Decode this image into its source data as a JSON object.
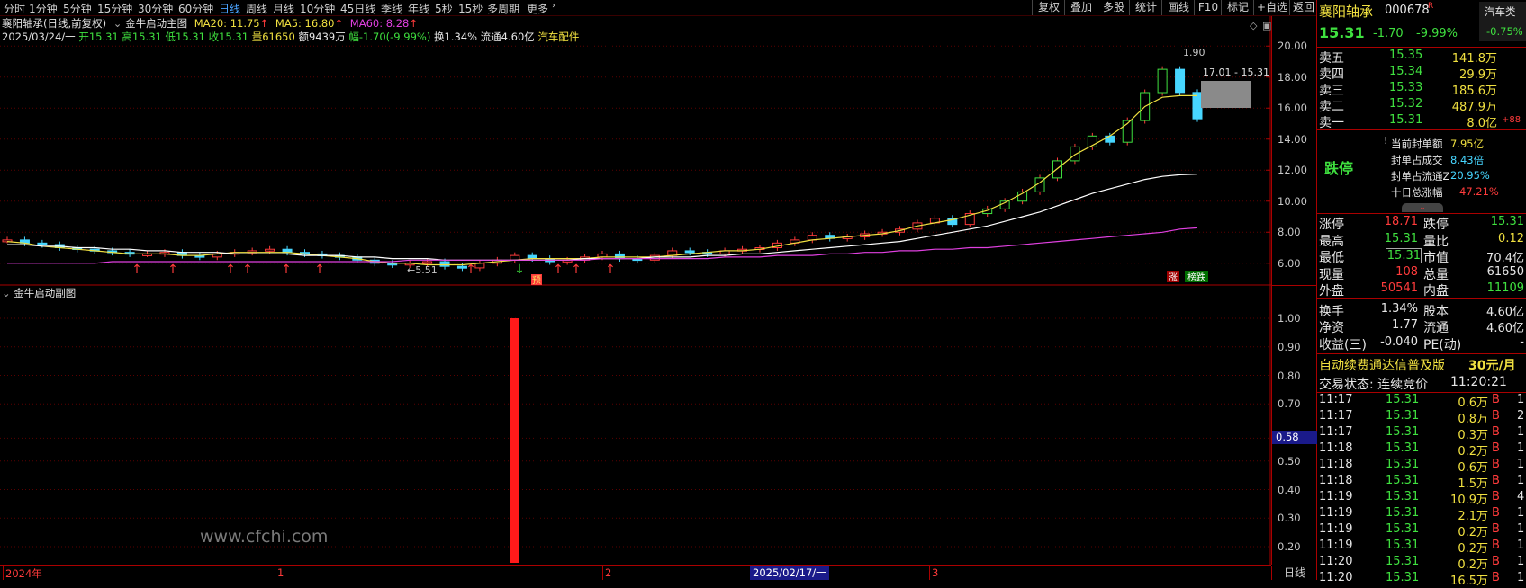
{
  "toolbar": {
    "periods": [
      "分时",
      "1分钟",
      "5分钟",
      "15分钟",
      "30分钟",
      "60分钟",
      "日线",
      "周线",
      "月线",
      "10分钟",
      "45日线",
      "季线",
      "年线",
      "5秒",
      "15秒",
      "多周期",
      "更多"
    ],
    "active": "日线",
    "right_buttons": [
      "复权",
      "叠加",
      "多股",
      "统计",
      "画线",
      "F10",
      "标记",
      "+自选",
      "返回"
    ]
  },
  "chart_header": {
    "title": "襄阳轴承(日线,前复权)",
    "indicator": "金牛启动主图",
    "ma20": "MA20: 11.75",
    "ma5": "MA5: 16.80",
    "ma60": "MA60: 8.28",
    "ohlc_line": {
      "date": "2025/03/24/一",
      "open": "开15.31",
      "high": "高15.31",
      "low": "低15.31",
      "close": "收15.31",
      "volume": "量61650",
      "amount": "额9439万",
      "change": "幅-1.70(-9.99%)",
      "turnover": "换1.34%",
      "float": "流通4.60亿",
      "sector": "汽车配件"
    },
    "colors": {
      "ma20": "#f0e040",
      "ma5": "#ffffff",
      "ma60": "#e040e0",
      "up": "#ff3b3b",
      "down": "#47d6ff"
    }
  },
  "sub_header": {
    "title": "金牛启动副图"
  },
  "annotations": {
    "low_label": "5.51",
    "high_label": "1.90",
    "range_label": "17.01 - 15.31",
    "yu_badge": "预",
    "zhang_badge": "涨",
    "bangdie_badge": "榜跌",
    "watermark": "www.cfchi.com",
    "cursor_value": "0.58"
  },
  "xaxis": {
    "labels": [
      "2024年",
      "1",
      "2",
      "3"
    ],
    "cursor_date": "2025/02/17/一",
    "period": "日线"
  },
  "main_axis_ticks": [
    "20.00",
    "18.00",
    "16.00",
    "14.00",
    "12.00",
    "10.00",
    "8.00",
    "6.00"
  ],
  "sub_axis_ticks": [
    "1.00",
    "0.90",
    "0.80",
    "0.70",
    "0.50",
    "0.40",
    "0.30",
    "0.20"
  ],
  "chart_data": {
    "type": "line",
    "title": "襄阳轴承(日线,前复权)",
    "ylim": [
      5.0,
      21.0
    ],
    "candles_close": [
      7.5,
      7.3,
      7.2,
      7.0,
      6.9,
      6.8,
      6.7,
      6.6,
      6.6,
      6.7,
      6.5,
      6.4,
      6.6,
      6.7,
      6.8,
      6.9,
      6.7,
      6.6,
      6.5,
      6.4,
      6.2,
      6.0,
      5.9,
      6.0,
      6.1,
      5.8,
      5.7,
      6.0,
      6.2,
      6.5,
      6.3,
      6.1,
      6.2,
      6.4,
      6.6,
      6.3,
      6.2,
      6.5,
      6.8,
      6.7,
      6.6,
      6.8,
      6.9,
      7.0,
      7.3,
      7.5,
      7.8,
      7.6,
      7.7,
      7.9,
      8.0,
      8.2,
      8.6,
      8.9,
      8.5,
      9.2,
      9.5,
      10.0,
      10.6,
      11.5,
      12.6,
      13.5,
      14.2,
      13.8,
      15.2,
      17.0,
      18.5,
      17.01,
      15.31
    ],
    "series": [
      {
        "name": "MA5",
        "values": [
          7.4,
          7.3,
          7.1,
          7.0,
          6.9,
          6.8,
          6.7,
          6.6,
          6.6,
          6.6,
          6.5,
          6.5,
          6.6,
          6.7,
          6.7,
          6.7,
          6.7,
          6.6,
          6.5,
          6.4,
          6.3,
          6.1,
          6.0,
          6.0,
          5.9,
          5.9,
          5.9,
          6.0,
          6.1,
          6.2,
          6.3,
          6.3,
          6.3,
          6.3,
          6.4,
          6.4,
          6.4,
          6.4,
          6.5,
          6.6,
          6.7,
          6.8,
          6.8,
          6.9,
          7.1,
          7.3,
          7.5,
          7.6,
          7.7,
          7.8,
          7.9,
          8.1,
          8.4,
          8.6,
          8.8,
          9.1,
          9.4,
          9.9,
          10.5,
          11.2,
          12.1,
          13.0,
          13.6,
          14.2,
          15.0,
          16.1,
          16.7,
          16.8,
          16.8
        ]
      },
      {
        "name": "MA20",
        "values": [
          7.2,
          7.2,
          7.1,
          7.1,
          7.0,
          7.0,
          6.9,
          6.9,
          6.8,
          6.8,
          6.7,
          6.7,
          6.7,
          6.6,
          6.6,
          6.6,
          6.6,
          6.5,
          6.5,
          6.5,
          6.4,
          6.4,
          6.3,
          6.3,
          6.3,
          6.2,
          6.2,
          6.2,
          6.2,
          6.2,
          6.2,
          6.2,
          6.2,
          6.3,
          6.3,
          6.3,
          6.3,
          6.4,
          6.4,
          6.4,
          6.5,
          6.5,
          6.6,
          6.6,
          6.7,
          6.8,
          6.9,
          7.0,
          7.1,
          7.2,
          7.3,
          7.4,
          7.6,
          7.8,
          8.0,
          8.2,
          8.4,
          8.7,
          9.0,
          9.3,
          9.7,
          10.1,
          10.5,
          10.8,
          11.1,
          11.4,
          11.6,
          11.7,
          11.75
        ]
      },
      {
        "name": "MA60",
        "values": [
          6.0,
          6.0,
          6.0,
          6.0,
          6.0,
          6.0,
          6.1,
          6.1,
          6.1,
          6.1,
          6.1,
          6.1,
          6.1,
          6.1,
          6.1,
          6.1,
          6.1,
          6.1,
          6.1,
          6.1,
          6.1,
          6.1,
          6.1,
          6.2,
          6.2,
          6.2,
          6.2,
          6.2,
          6.2,
          6.2,
          6.2,
          6.2,
          6.2,
          6.2,
          6.3,
          6.3,
          6.3,
          6.3,
          6.3,
          6.3,
          6.3,
          6.4,
          6.4,
          6.4,
          6.5,
          6.5,
          6.5,
          6.6,
          6.6,
          6.7,
          6.7,
          6.8,
          6.8,
          6.9,
          6.9,
          7.0,
          7.0,
          7.1,
          7.2,
          7.3,
          7.4,
          7.5,
          7.6,
          7.7,
          7.8,
          7.9,
          8.0,
          8.2,
          8.28
        ]
      }
    ]
  },
  "stock": {
    "name": "襄阳轴承",
    "code": "000678",
    "flag": "R",
    "price": "15.31",
    "change": "-1.70",
    "pct": "-9.99%",
    "sector_name": "汽车类",
    "sector_pct": "-0.75%"
  },
  "order_book": [
    {
      "label": "卖五",
      "price": "15.35",
      "vol": "141.8万",
      "extra": ""
    },
    {
      "label": "卖四",
      "price": "15.34",
      "vol": "29.9万",
      "extra": ""
    },
    {
      "label": "卖三",
      "price": "15.33",
      "vol": "185.6万",
      "extra": ""
    },
    {
      "label": "卖二",
      "price": "15.32",
      "vol": "487.9万",
      "extra": ""
    },
    {
      "label": "卖一",
      "price": "15.31",
      "vol": "8.0亿",
      "extra": "+88"
    }
  ],
  "limit_panel": {
    "status": "跌停",
    "lines": [
      {
        "label": "当前封单额",
        "value": "7.95亿"
      },
      {
        "label": "封单占成交",
        "value": "8.43倍"
      },
      {
        "label": "封单占流通Z",
        "value": "20.95%"
      },
      {
        "label": "十日总涨幅",
        "value": "47.21%"
      }
    ]
  },
  "stats": [
    {
      "l1": "涨停",
      "v1": "18.71",
      "l2": "跌停",
      "v2": "15.31"
    },
    {
      "l1": "最高",
      "v1": "15.31",
      "l2": "量比",
      "v2": "0.12"
    },
    {
      "l1": "最低",
      "v1": "15.31",
      "l2": "市值",
      "v2": "70.4亿"
    },
    {
      "l1": "现量",
      "v1": "108",
      "l2": "总量",
      "v2": "61650"
    },
    {
      "l1": "外盘",
      "v1": "50541",
      "l2": "内盘",
      "v2": "11109"
    },
    {
      "l1": "换手",
      "v1": "1.34%",
      "l2": "股本",
      "v2": "4.60亿"
    },
    {
      "l1": "净资",
      "v1": "1.77",
      "l2": "流通",
      "v2": "4.60亿"
    },
    {
      "l1": "收益(三)",
      "v1": "-0.040",
      "l2": "PE(动)",
      "v2": "-"
    }
  ],
  "promo": {
    "text": "自动续费通达信普及版",
    "price": "30元/月"
  },
  "trade_status": {
    "label": "交易状态: 连续竞价",
    "time": "11:20:21"
  },
  "ticks": [
    {
      "t": "11:17",
      "p": "15.31",
      "v": "0.6万",
      "bs": "B",
      "n": "1"
    },
    {
      "t": "11:17",
      "p": "15.31",
      "v": "0.8万",
      "bs": "B",
      "n": "2"
    },
    {
      "t": "11:17",
      "p": "15.31",
      "v": "0.3万",
      "bs": "B",
      "n": "1"
    },
    {
      "t": "11:18",
      "p": "15.31",
      "v": "0.2万",
      "bs": "B",
      "n": "1"
    },
    {
      "t": "11:18",
      "p": "15.31",
      "v": "0.6万",
      "bs": "B",
      "n": "1"
    },
    {
      "t": "11:18",
      "p": "15.31",
      "v": "1.5万",
      "bs": "B",
      "n": "1"
    },
    {
      "t": "11:19",
      "p": "15.31",
      "v": "10.9万",
      "bs": "B",
      "n": "4"
    },
    {
      "t": "11:19",
      "p": "15.31",
      "v": "2.1万",
      "bs": "B",
      "n": "1"
    },
    {
      "t": "11:19",
      "p": "15.31",
      "v": "0.2万",
      "bs": "B",
      "n": "1"
    },
    {
      "t": "11:19",
      "p": "15.31",
      "v": "0.2万",
      "bs": "B",
      "n": "1"
    },
    {
      "t": "11:20",
      "p": "15.31",
      "v": "0.2万",
      "bs": "B",
      "n": "1"
    },
    {
      "t": "11:20",
      "p": "15.31",
      "v": "16.5万",
      "bs": "B",
      "n": "1"
    }
  ]
}
